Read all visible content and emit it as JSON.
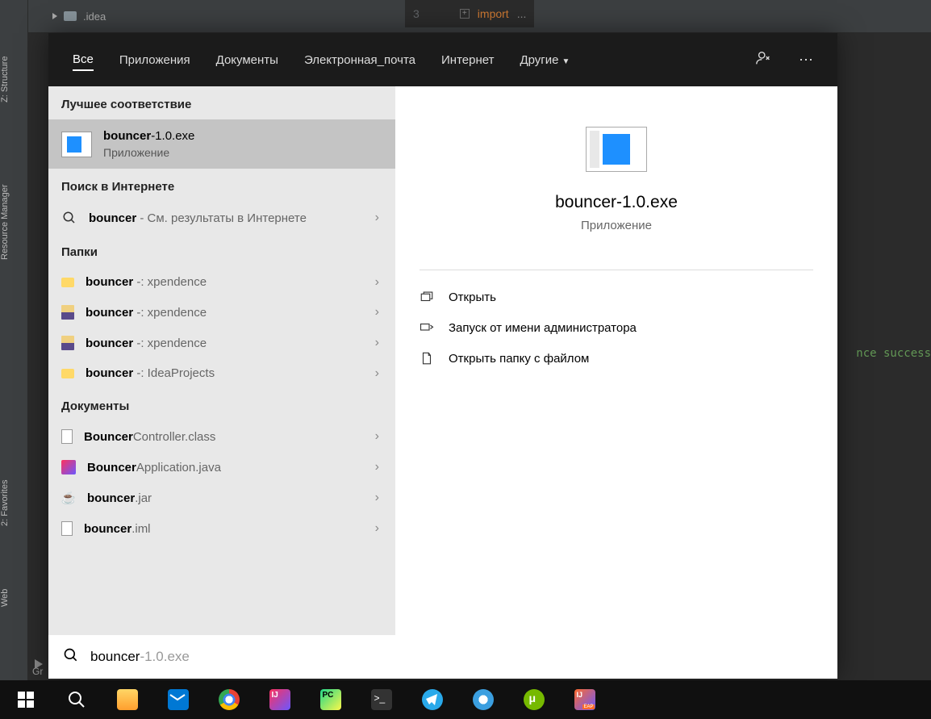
{
  "ide": {
    "sideTabs": {
      "structure": "Z: Structure",
      "resource": "Resource Manager",
      "favorites": "2: Favorites",
      "web": "Web"
    },
    "folderName": ".idea",
    "lineNumber": "3",
    "importKeyword": "import",
    "dots": "...",
    "successText": "nce success",
    "grLabel": "Gr"
  },
  "search": {
    "tabs": {
      "all": "Все",
      "apps": "Приложения",
      "docs": "Документы",
      "email": "Электронная_почта",
      "internet": "Интернет",
      "other": "Другие"
    },
    "sections": {
      "bestMatch": "Лучшее соответствие",
      "webSearch": "Поиск в Интернете",
      "folders": "Папки",
      "documents": "Документы"
    },
    "bestMatch": {
      "title": "bouncer",
      "titleSuffix": "-1.0.exe",
      "sub": "Приложение"
    },
    "webSearch": {
      "bold": "bouncer",
      "suffix": " - См. результаты в Интернете"
    },
    "folders": [
      {
        "bold": "bouncer",
        "suffix": " -: xpendence",
        "icon": "folder-y"
      },
      {
        "bold": "bouncer",
        "suffix": " -: xpendence",
        "icon": "folder-p"
      },
      {
        "bold": "bouncer",
        "suffix": " -: xpendence",
        "icon": "folder-p"
      },
      {
        "bold": "bouncer",
        "suffix": " -: IdeaProjects",
        "icon": "folder-y"
      }
    ],
    "documents": [
      {
        "bold": "Bouncer",
        "suffix": "Controller.class",
        "icon": "doc"
      },
      {
        "bold": "Bouncer",
        "suffix": "Application.java",
        "icon": "ij"
      },
      {
        "bold": "bouncer",
        "suffix": ".jar",
        "icon": "java"
      },
      {
        "bold": "bouncer",
        "suffix": ".iml",
        "icon": "doc"
      }
    ],
    "preview": {
      "title": "bouncer-1.0.exe",
      "sub": "Приложение"
    },
    "actions": {
      "open": "Открыть",
      "runAdmin": "Запуск от имени администратора",
      "openFolder": "Открыть папку с файлом"
    },
    "query": {
      "text": "bouncer",
      "suffix": "-1.0.exe"
    }
  }
}
